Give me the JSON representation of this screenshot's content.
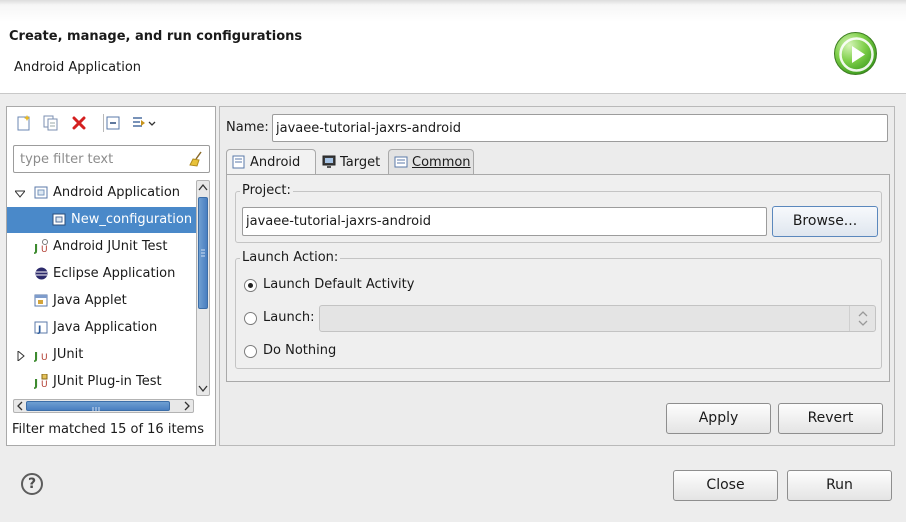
{
  "header": {
    "title": "Create, manage, and run configurations",
    "subtitle": "Android Application"
  },
  "left": {
    "toolbar": [
      "new-configuration-icon",
      "duplicate-icon",
      "delete-icon",
      "collapse-all-icon",
      "filter-menu-icon"
    ],
    "filter_placeholder": "type filter text",
    "tree": [
      {
        "label": "Android Application",
        "icon": "android-app-icon",
        "expanded": true
      },
      {
        "label": "New_configuration",
        "icon": "android-config-icon",
        "selected": true
      },
      {
        "label": "Android JUnit Test",
        "icon": "junit-test-icon"
      },
      {
        "label": "Eclipse Application",
        "icon": "eclipse-icon"
      },
      {
        "label": "Java Applet",
        "icon": "java-applet-icon"
      },
      {
        "label": "Java Application",
        "icon": "java-app-icon"
      },
      {
        "label": "JUnit",
        "icon": "junit-icon",
        "expandable": true
      },
      {
        "label": "JUnit Plug-in Test",
        "icon": "junit-plugin-icon"
      }
    ],
    "filter_status": "Filter matched 15 of 16 items"
  },
  "right": {
    "name_label": "Name:",
    "name_value": "javaee-tutorial-jaxrs-android",
    "tabs": [
      {
        "label": "Android",
        "icon": "android-tab-icon",
        "active": true
      },
      {
        "label": "Target",
        "icon": "target-tab-icon"
      },
      {
        "label": "Common",
        "icon": "common-tab-icon"
      }
    ],
    "project": {
      "title": "Project:",
      "value": "javaee-tutorial-jaxrs-android",
      "browse_label": "Browse..."
    },
    "launch_action": {
      "title": "Launch Action:",
      "options": [
        "Launch Default Activity",
        "Launch:",
        "Do Nothing"
      ],
      "selected_index": 0,
      "launch_value": ""
    },
    "apply_label": "Apply",
    "revert_label": "Revert"
  },
  "footer": {
    "help_glyph": "?",
    "close_label": "Close",
    "run_label": "Run"
  }
}
